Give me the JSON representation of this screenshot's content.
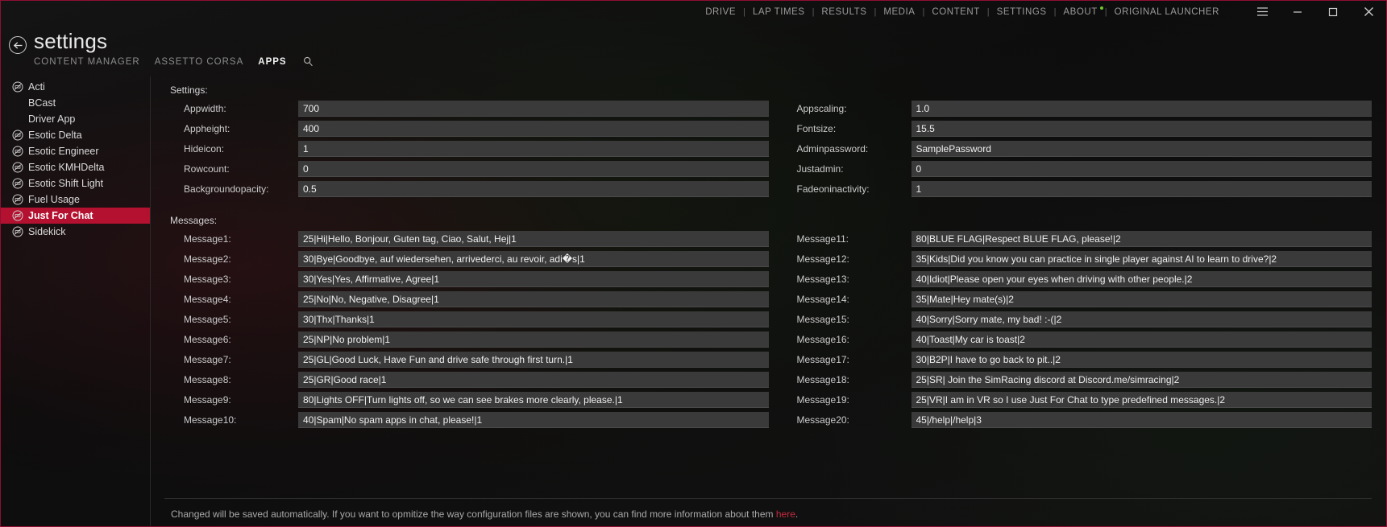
{
  "titlebar": {
    "nav": [
      {
        "label": "DRIVE",
        "dot": false
      },
      {
        "label": "LAP TIMES",
        "dot": false
      },
      {
        "label": "RESULTS",
        "dot": false
      },
      {
        "label": "MEDIA",
        "dot": false
      },
      {
        "label": "CONTENT",
        "dot": false
      },
      {
        "label": "SETTINGS",
        "dot": false
      },
      {
        "label": "ABOUT",
        "dot": true
      },
      {
        "label": "ORIGINAL LAUNCHER",
        "dot": false
      }
    ],
    "separator": "|",
    "menu_label": "☰",
    "minimize_label": "–",
    "maximize_label": "☐",
    "close_label": "✕"
  },
  "header": {
    "title": "settings",
    "back_label": "←",
    "subtabs": [
      {
        "label": "CONTENT MANAGER",
        "active": false
      },
      {
        "label": "ASSETTO CORSA",
        "active": false
      },
      {
        "label": "APPS",
        "active": true
      }
    ],
    "search_label": "⌕"
  },
  "sidebar": {
    "items": [
      {
        "label": "Acti",
        "icon": true,
        "active": false
      },
      {
        "label": "BCast",
        "icon": false,
        "active": false
      },
      {
        "label": "Driver App",
        "icon": false,
        "active": false
      },
      {
        "label": "Esotic Delta",
        "icon": true,
        "active": false
      },
      {
        "label": "Esotic Engineer",
        "icon": true,
        "active": false
      },
      {
        "label": "Esotic KMHDelta",
        "icon": true,
        "active": false
      },
      {
        "label": "Esotic Shift Light",
        "icon": true,
        "active": false
      },
      {
        "label": "Fuel Usage",
        "icon": true,
        "active": false
      },
      {
        "label": "Just For Chat",
        "icon": true,
        "active": true
      },
      {
        "label": "Sidekick",
        "icon": true,
        "active": false
      }
    ]
  },
  "main": {
    "settings_title": "Settings:",
    "messages_title": "Messages:",
    "settings_left": [
      {
        "label": "Appwidth:",
        "value": "700"
      },
      {
        "label": "Appheight:",
        "value": "400"
      },
      {
        "label": "Hideicon:",
        "value": "1"
      },
      {
        "label": "Rowcount:",
        "value": "0"
      },
      {
        "label": "Backgroundopacity:",
        "value": "0.5"
      }
    ],
    "settings_right": [
      {
        "label": "Appscaling:",
        "value": "1.0"
      },
      {
        "label": "Fontsize:",
        "value": "15.5"
      },
      {
        "label": "Adminpassword:",
        "value": "SamplePassword"
      },
      {
        "label": "Justadmin:",
        "value": "0"
      },
      {
        "label": "Fadeoninactivity:",
        "value": "1"
      }
    ],
    "messages_left": [
      {
        "label": "Message1:",
        "value": "25|Hi|Hello, Bonjour, Guten tag, Ciao, Salut, Hej|1"
      },
      {
        "label": "Message2:",
        "value": "30|Bye|Goodbye, auf wiedersehen, arrivederci, au revoir, adi�s|1"
      },
      {
        "label": "Message3:",
        "value": "30|Yes|Yes, Affirmative, Agree|1"
      },
      {
        "label": "Message4:",
        "value": "25|No|No, Negative, Disagree|1"
      },
      {
        "label": "Message5:",
        "value": "30|Thx|Thanks|1"
      },
      {
        "label": "Message6:",
        "value": "25|NP|No problem|1"
      },
      {
        "label": "Message7:",
        "value": "25|GL|Good Luck, Have Fun and drive safe through first turn.|1"
      },
      {
        "label": "Message8:",
        "value": "25|GR|Good race|1"
      },
      {
        "label": "Message9:",
        "value": "80|Lights OFF|Turn lights off, so we can see brakes more clearly, please.|1"
      },
      {
        "label": "Message10:",
        "value": "40|Spam|No spam apps in chat, please!|1"
      }
    ],
    "messages_right": [
      {
        "label": "Message11:",
        "value": "80|BLUE FLAG|Respect BLUE FLAG, please!|2"
      },
      {
        "label": "Message12:",
        "value": "35|Kids|Did you know you can practice in single player against AI to learn to drive?|2"
      },
      {
        "label": "Message13:",
        "value": "40|Idiot|Please open your eyes when driving with other people.|2"
      },
      {
        "label": "Message14:",
        "value": "35|Mate|Hey mate(s)|2"
      },
      {
        "label": "Message15:",
        "value": "40|Sorry|Sorry mate, my bad! :-(|2"
      },
      {
        "label": "Message16:",
        "value": "40|Toast|My car is toast|2"
      },
      {
        "label": "Message17:",
        "value": "30|B2P|I have to go back to pit..|2"
      },
      {
        "label": "Message18:",
        "value": "25|SR| Join the SimRacing discord at Discord.me/simracing|2"
      },
      {
        "label": "Message19:",
        "value": "25|VR|I am in VR so I use Just For Chat to type predefined messages.|2"
      },
      {
        "label": "Message20:",
        "value": "45|/help|/help|3"
      }
    ]
  },
  "footer": {
    "note_before": "Changed will be saved automatically. If you want to opmitize the way configuration files are shown, you can find more information about them ",
    "note_link": "here",
    "note_after": "."
  },
  "colors": {
    "accent": "#b4102f",
    "link": "#c42a3e",
    "field_bg": "#3a3a3a",
    "text": "#e9e9e9"
  }
}
